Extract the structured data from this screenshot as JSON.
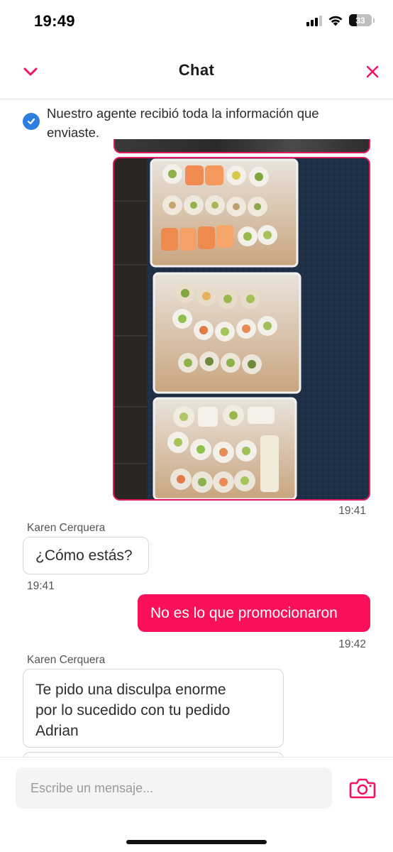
{
  "status_bar": {
    "time": "19:49",
    "battery_level": "33",
    "icons": [
      "cellular-signal-icon",
      "wifi-icon",
      "battery-icon"
    ]
  },
  "header": {
    "title": "Chat",
    "collapse_icon": "chevron-down-icon",
    "close_icon": "close-icon"
  },
  "notice": {
    "icon": "check-circle-icon",
    "text": "Nuestro agente recibió toda la información que enviaste."
  },
  "messages": [
    {
      "type": "image",
      "from": "user",
      "description_icon": "photo-sushi-trays",
      "time": "19:41"
    },
    {
      "type": "text",
      "from": "agent",
      "sender": "Karen Cerquera",
      "text": "¿Cómo estás?",
      "time": "19:41"
    },
    {
      "type": "text",
      "from": "user",
      "text": "No es lo que promocionaron",
      "time": "19:42"
    },
    {
      "type": "text",
      "from": "agent",
      "sender": "Karen Cerquera",
      "lines": [
        "Te pido una disculpa enorme",
        "por lo sucedido con tu pedido",
        "Adrian"
      ]
    }
  ],
  "composer": {
    "placeholder": "Escribe un mensaje...",
    "camera_icon": "camera-icon"
  },
  "colors": {
    "accent": "#fa0f5a",
    "border_accent": "#e21a5f",
    "check_blue": "#2f7de1"
  }
}
